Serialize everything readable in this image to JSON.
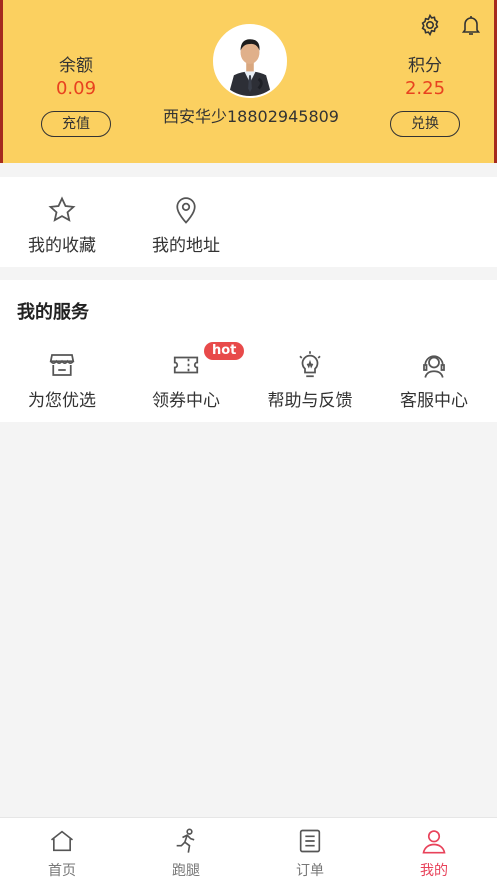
{
  "header": {
    "balance_label": "余额",
    "balance_value": "0.09",
    "recharge_label": "充值",
    "points_label": "积分",
    "points_value": "2.25",
    "exchange_label": "兑换",
    "username": "西安华少18802945809",
    "settings_icon": "gear-icon",
    "notification_icon": "bell-icon"
  },
  "quick": {
    "items": [
      {
        "label": "我的收藏",
        "icon": "star-icon"
      },
      {
        "label": "我的地址",
        "icon": "location-pin-icon"
      }
    ]
  },
  "services": {
    "title": "我的服务",
    "items": [
      {
        "label": "为您优选",
        "icon": "store-icon"
      },
      {
        "label": "领券中心",
        "icon": "ticket-icon",
        "badge": "hot"
      },
      {
        "label": "帮助与反馈",
        "icon": "lightbulb-icon"
      },
      {
        "label": "客服中心",
        "icon": "headset-icon"
      }
    ]
  },
  "tabbar": {
    "items": [
      {
        "label": "首页",
        "icon": "home-icon"
      },
      {
        "label": "跑腿",
        "icon": "runner-icon"
      },
      {
        "label": "订单",
        "icon": "order-list-icon"
      },
      {
        "label": "我的",
        "icon": "user-icon",
        "active": true
      }
    ]
  },
  "colors": {
    "header_bg": "#fbd060",
    "value_red": "#e8421f",
    "active_tab": "#e8425a",
    "hot_badge": "#e84a4a"
  }
}
